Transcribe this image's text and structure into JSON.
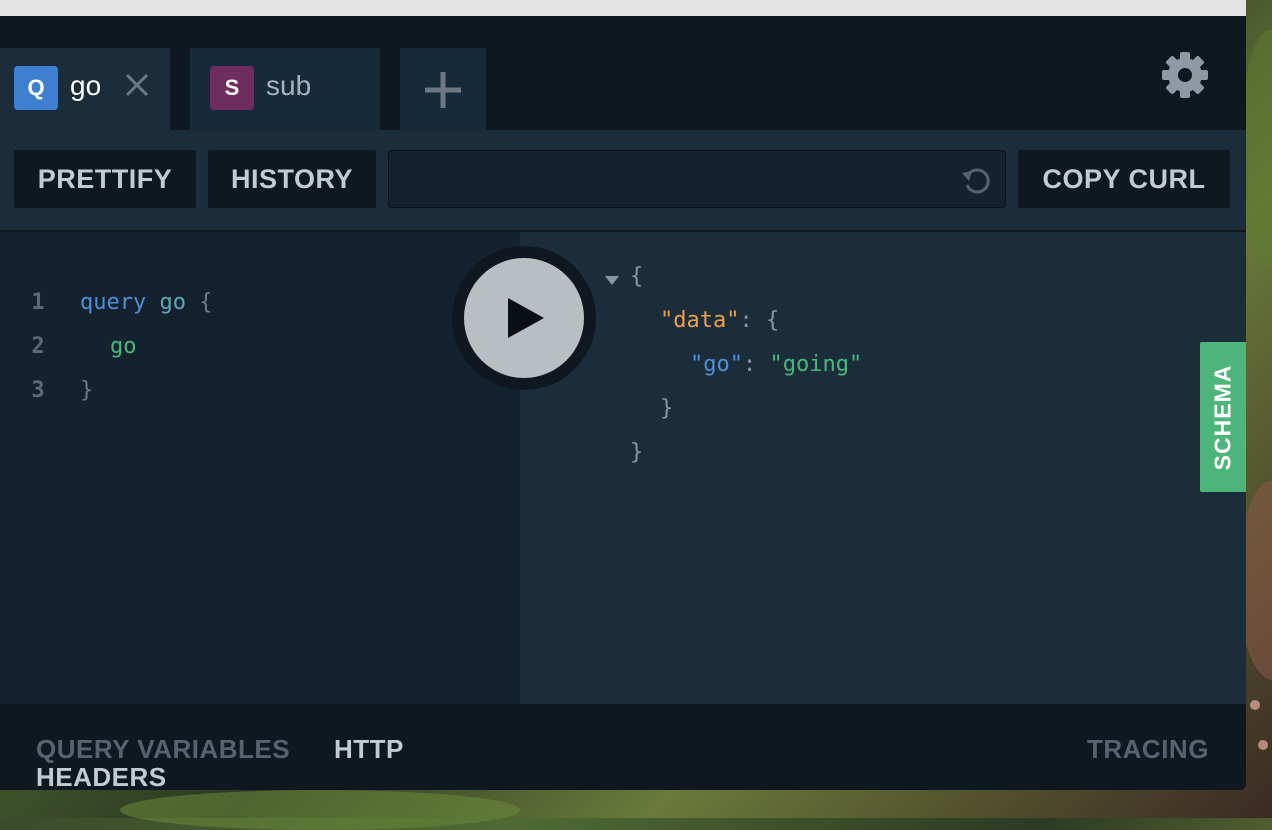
{
  "tabs": [
    {
      "badge": "Q",
      "name": "go",
      "badge_color": "#3e80d0",
      "active": true
    },
    {
      "badge": "S",
      "name": "sub",
      "badge_color": "#6e2d5c",
      "active": false
    }
  ],
  "toolbar": {
    "prettify_label": "PRETTIFY",
    "history_label": "HISTORY",
    "endpoint_value": "",
    "copy_curl_label": "COPY CURL"
  },
  "editor": {
    "lines": [
      {
        "num": "1",
        "keyword": "query",
        "name": "go",
        "brace": "{"
      },
      {
        "num": "2",
        "field": "go"
      },
      {
        "num": "3",
        "brace": "}"
      }
    ]
  },
  "result": {
    "open_brace": "{",
    "data_key": "\"data\"",
    "colon": ":",
    "inner_open": "{",
    "go_key": "\"go\"",
    "go_value": "\"going\"",
    "inner_close": "}",
    "close_brace": "}"
  },
  "schema_label": "SCHEMA",
  "bottom": {
    "query_variables": "QUERY VARIABLES",
    "http_headers_1": "HTTP",
    "http_headers_2": "HEADERS",
    "tracing": "TRACING"
  },
  "colors": {
    "accent_query": "#3e80d0",
    "accent_subscription": "#6e2d5c",
    "schema_green": "#4eb57a",
    "background": "#0f1821"
  },
  "icons": [
    "close-icon",
    "plus-icon",
    "gear-icon",
    "reload-icon",
    "play-icon",
    "collapse-arrow-icon"
  ]
}
